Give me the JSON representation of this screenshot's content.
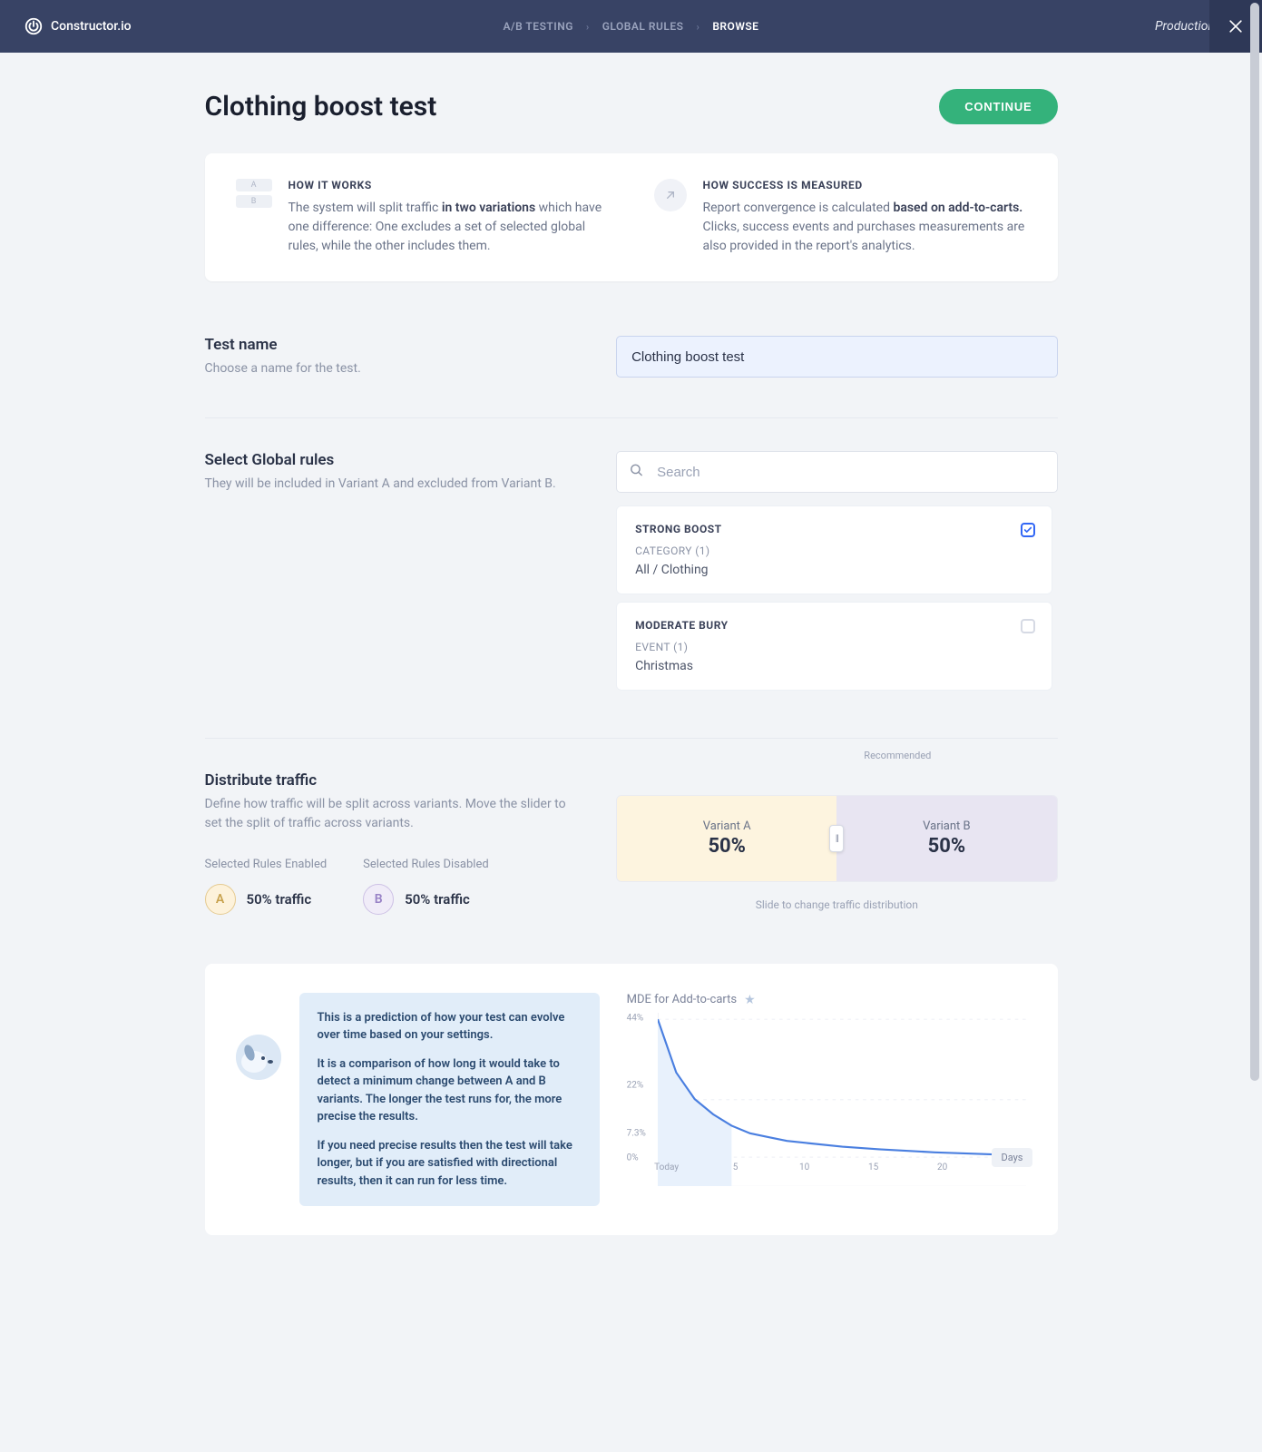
{
  "brand": "Constructor.io",
  "breadcrumb": {
    "a": "A/B TESTING",
    "b": "GLOBAL RULES",
    "c": "BROWSE"
  },
  "env": "Production",
  "page_title": "Clothing boost test",
  "continue_label": "CONTINUE",
  "info": {
    "how_works_h": "HOW IT WORKS",
    "how_works_pre": "The system will split traffic ",
    "how_works_bold": "in two variations",
    "how_works_post": " which have one difference: One excludes a set of selected global rules, while the other includes them.",
    "how_success_h": "HOW SUCCESS IS MEASURED",
    "how_success_pre": "Report convergence is calculated ",
    "how_success_bold": "based on add-to-carts.",
    "how_success_post": " Clicks, success events and purchases measurements are also provided in the report's analytics."
  },
  "test_name": {
    "h": "Test name",
    "sub": "Choose a name for the test.",
    "value": "Clothing boost test"
  },
  "global_rules": {
    "h": "Select Global rules",
    "sub": "They will be included in Variant A and excluded from Variant B.",
    "search_placeholder": "Search",
    "items": [
      {
        "title": "STRONG BOOST",
        "meta": "CATEGORY (1)",
        "value": "All / Clothing",
        "checked": true
      },
      {
        "title": "MODERATE BURY",
        "meta": "EVENT (1)",
        "value": "Christmas",
        "checked": false
      }
    ]
  },
  "distribute": {
    "h": "Distribute traffic",
    "sub": "Define how traffic will be split across variants. Move the slider to set the split of traffic across variants.",
    "enabled_h": "Selected Rules Enabled",
    "disabled_h": "Selected Rules Disabled",
    "a_traffic": "50% traffic",
    "b_traffic": "50% traffic",
    "a_letter": "A",
    "b_letter": "B",
    "recommended": "Recommended",
    "variant_a_label": "Variant A",
    "variant_b_label": "Variant B",
    "variant_a_pct": "50%",
    "variant_b_pct": "50%",
    "slider_caption": "Slide to change traffic distribution"
  },
  "prediction": {
    "p1": "This is a prediction of how your test can evolve over time based on your settings.",
    "p2": "It is a comparison of how long it would take to detect a minimum change between A and B variants. The longer the test runs for, the more precise the results.",
    "p3": "If you need precise results then the test will take longer, but if you are satisfied with directional results, then it can run for less time.",
    "chart_title": "MDE for Add-to-carts",
    "days_label": "Days"
  },
  "chart_data": {
    "type": "line",
    "title": "MDE for Add-to-carts",
    "xlabel": "Days",
    "ylabel": "",
    "y_ticks": [
      "44%",
      "22%",
      "7.3%",
      "0%"
    ],
    "x_ticks": [
      "Today",
      "5",
      "10",
      "15",
      "20"
    ],
    "x": [
      0,
      1,
      2,
      3,
      4,
      5,
      6,
      7,
      8,
      10,
      12,
      15,
      18,
      20
    ],
    "y": [
      44,
      30,
      23,
      19,
      16,
      14,
      13,
      12,
      11.5,
      10.5,
      9.8,
      9,
      8.5,
      8.2
    ],
    "ylim": [
      0,
      44
    ],
    "xlim": [
      0,
      20
    ]
  }
}
